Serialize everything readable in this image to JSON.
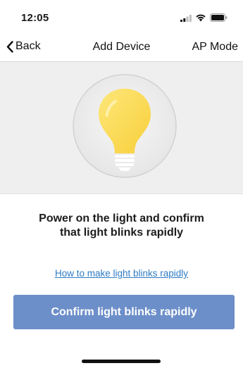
{
  "status_bar": {
    "time": "12:05"
  },
  "nav": {
    "back_label": "Back",
    "title": "Add Device",
    "right_label": "AP Mode"
  },
  "main": {
    "illustration_icon": "lightbulb-icon",
    "instruction_line1": "Power on the light and confirm",
    "instruction_line2": "that light blinks  rapidly",
    "help_link": "How to make light blinks rapidly",
    "confirm_button": "Confirm light blinks rapidly"
  },
  "colors": {
    "accent": "#6d8fc9",
    "link": "#2f7bc4",
    "bulb": "#fbd84b",
    "hero_background": "#efefef"
  }
}
